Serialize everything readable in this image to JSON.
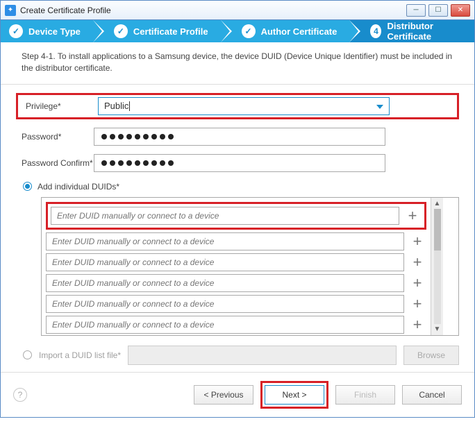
{
  "window": {
    "title": "Create Certificate Profile"
  },
  "wizard": {
    "steps": [
      {
        "label": "Device Type",
        "done": true
      },
      {
        "label": "Certificate Profile",
        "done": true
      },
      {
        "label": "Author Certificate",
        "done": true
      },
      {
        "number": "4",
        "label": "Distributor Certificate",
        "active": true
      }
    ]
  },
  "instruction": "Step 4-1. To install applications to a Samsung device, the device DUID (Device Unique Identifier) must be included in the distributor certificate.",
  "form": {
    "privilege_label": "Privilege*",
    "privilege_value": "Public",
    "password_label": "Password*",
    "password_confirm_label": "Password Confirm*",
    "password_dots": 9,
    "radio_add_label": "Add individual DUIDs*",
    "radio_import_label": "Import a DUID list file*",
    "duid_placeholder": "Enter DUID manually or connect to a device",
    "browse_label": "Browse"
  },
  "footer": {
    "previous": "< Previous",
    "next": "Next >",
    "finish": "Finish",
    "cancel": "Cancel"
  }
}
